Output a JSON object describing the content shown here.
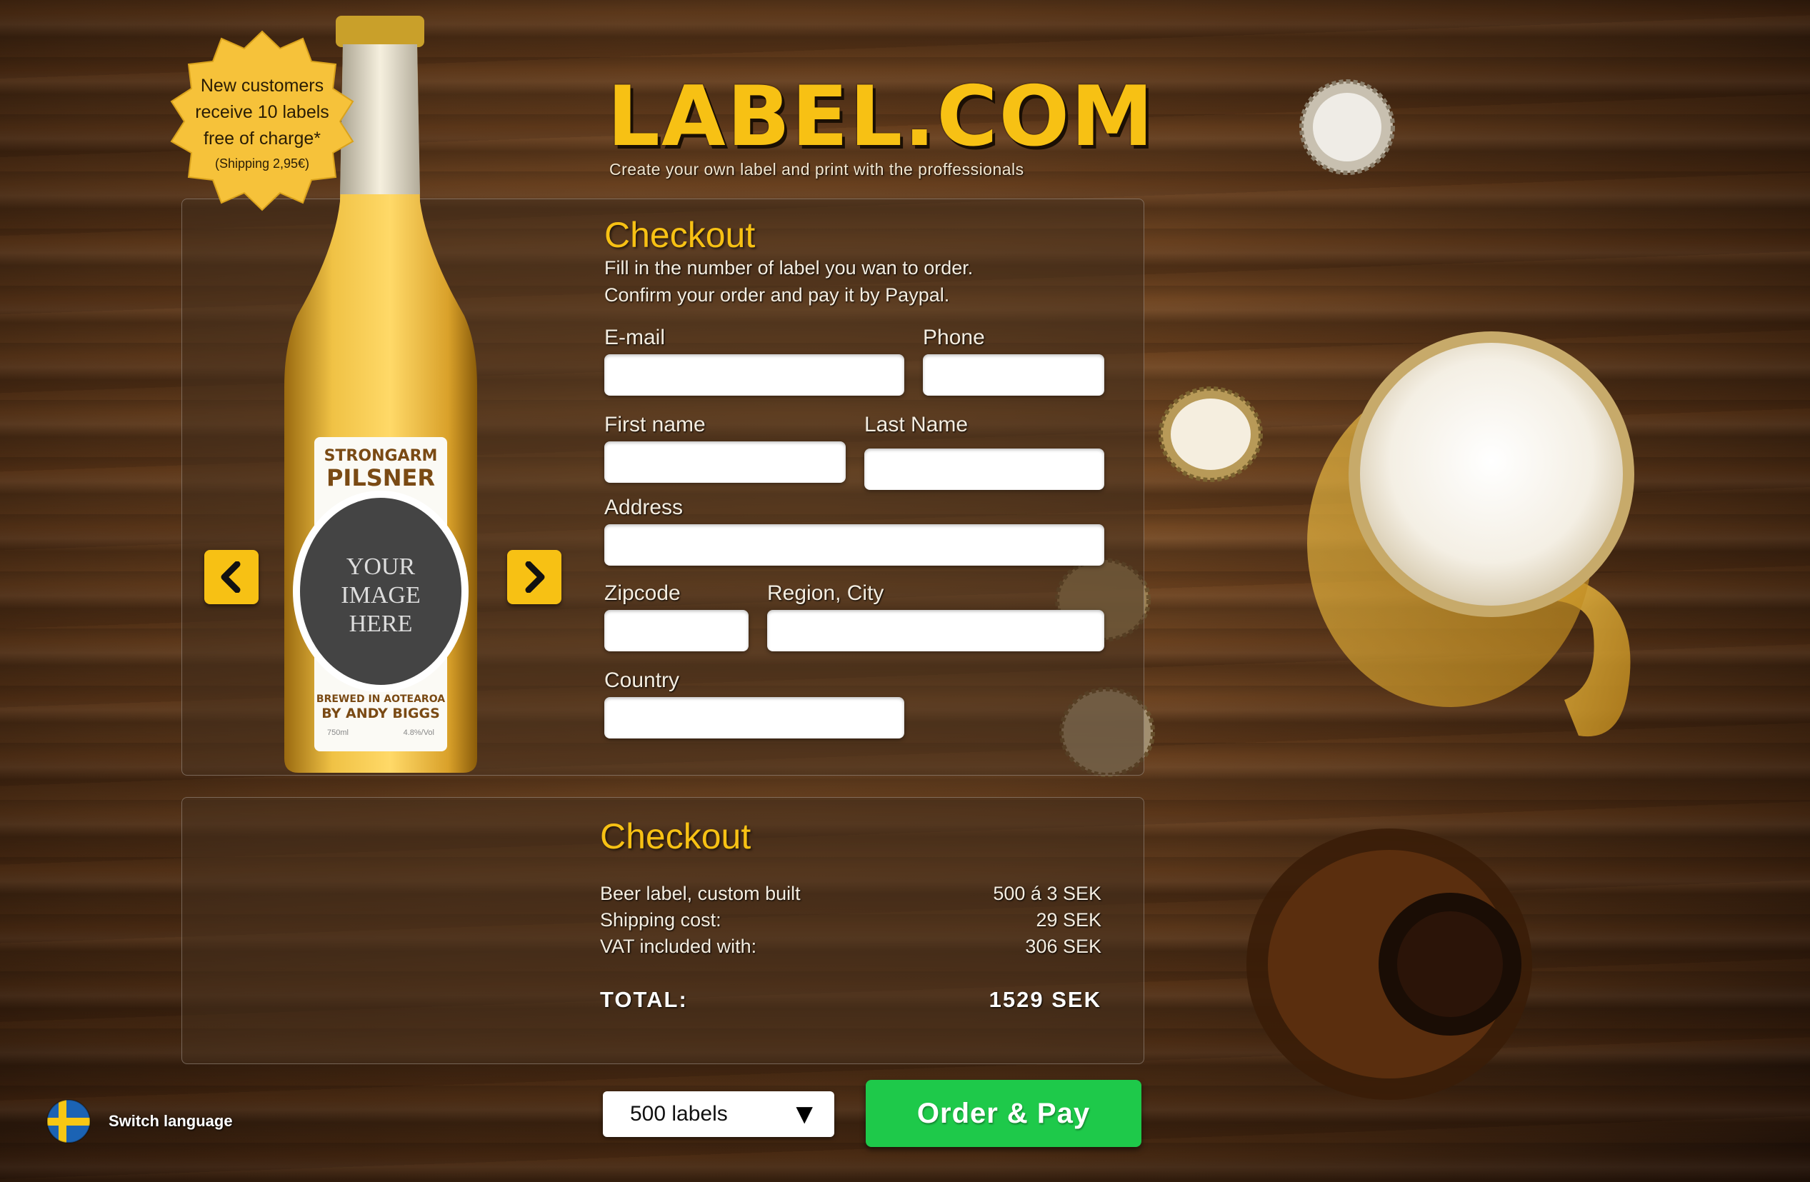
{
  "header": {
    "logo": "LABEL.COM",
    "tagline": "Create your own label and print with the proffessionals"
  },
  "promo": {
    "line1": "New customers",
    "line2": "receive 10 labels",
    "line3": "free of charge*",
    "note": "(Shipping 2,95€)"
  },
  "product": {
    "brand_line1": "STRONGARM",
    "brand_line2": "PILSNER",
    "image_placeholder_1": "YOUR",
    "image_placeholder_2": "IMAGE",
    "image_placeholder_3": "HERE",
    "brewed_line1": "BREWED IN AOTEAROA",
    "brewed_line2": "BY ANDY BIGGS",
    "volume": "750ml",
    "abv": "4.8%/Vol",
    "prev_icon": "chevron-left-icon",
    "next_icon": "chevron-right-icon"
  },
  "form": {
    "title": "Checkout",
    "intro_line1": "Fill in the number of label you wan to order.",
    "intro_line2": "Confirm your order and pay it by Paypal.",
    "labels": {
      "email": "E-mail",
      "phone": "Phone",
      "first_name": "First name",
      "last_name": "Last Name",
      "address": "Address",
      "zipcode": "Zipcode",
      "region_city": "Region, City",
      "country": "Country"
    },
    "values": {
      "email": "",
      "phone": "",
      "first_name": "",
      "last_name": "",
      "address": "",
      "zipcode": "",
      "region_city": "",
      "country": ""
    }
  },
  "summary": {
    "title": "Checkout",
    "rows": [
      {
        "label": "Beer label, custom built",
        "value": "500 á  3 SEK"
      },
      {
        "label": "Shipping cost:",
        "value": "29 SEK"
      },
      {
        "label": "VAT included with:",
        "value": "306 SEK"
      }
    ],
    "total_label": "TOTAL:",
    "total_value": "1529 SEK"
  },
  "footer": {
    "quantity_selected": "500 labels",
    "order_button": "Order & Pay",
    "switch_language": "Switch language",
    "flag_icon": "sweden-flag-icon"
  },
  "colors": {
    "accent": "#f7c114",
    "order_button": "#1ec94a"
  }
}
